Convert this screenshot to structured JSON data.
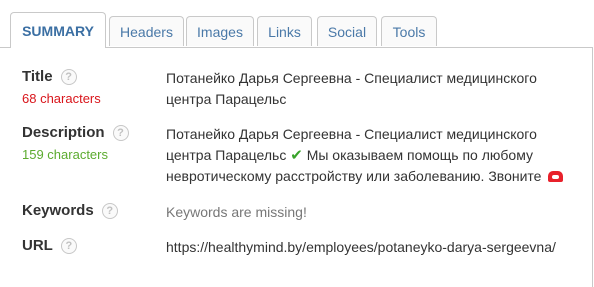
{
  "tabs": [
    {
      "label": "SUMMARY",
      "active": true
    },
    {
      "label": "Headers"
    },
    {
      "label": "Images"
    },
    {
      "label": "Links"
    },
    {
      "label": "Social"
    },
    {
      "label": "Tools"
    }
  ],
  "help_symbol": "?",
  "rows": {
    "title": {
      "label": "Title",
      "count": "68 characters",
      "value": "Потанейко Дарья Сергеевна - Специалист медицинского центра Парацельс"
    },
    "description": {
      "label": "Description",
      "count": "159 characters",
      "value_part1": "Потанейко Дарья Сергеевна - Специалист медицинского центра Парацельс",
      "check_glyph": "✔",
      "value_part2": "Мы оказываем помощь по любому невротическому расстройству или заболеванию. Звоните",
      "trailing_icon": "telephone-icon"
    },
    "keywords": {
      "label": "Keywords",
      "value": "Keywords are missing!"
    },
    "url": {
      "label": "URL",
      "value": "https://healthymind.by/employees/potaneyko-darya-sergeevna/"
    }
  },
  "colors": {
    "accent": "#3b6fa3",
    "count_bad": "#d9151b",
    "count_good": "#5cab2f"
  }
}
